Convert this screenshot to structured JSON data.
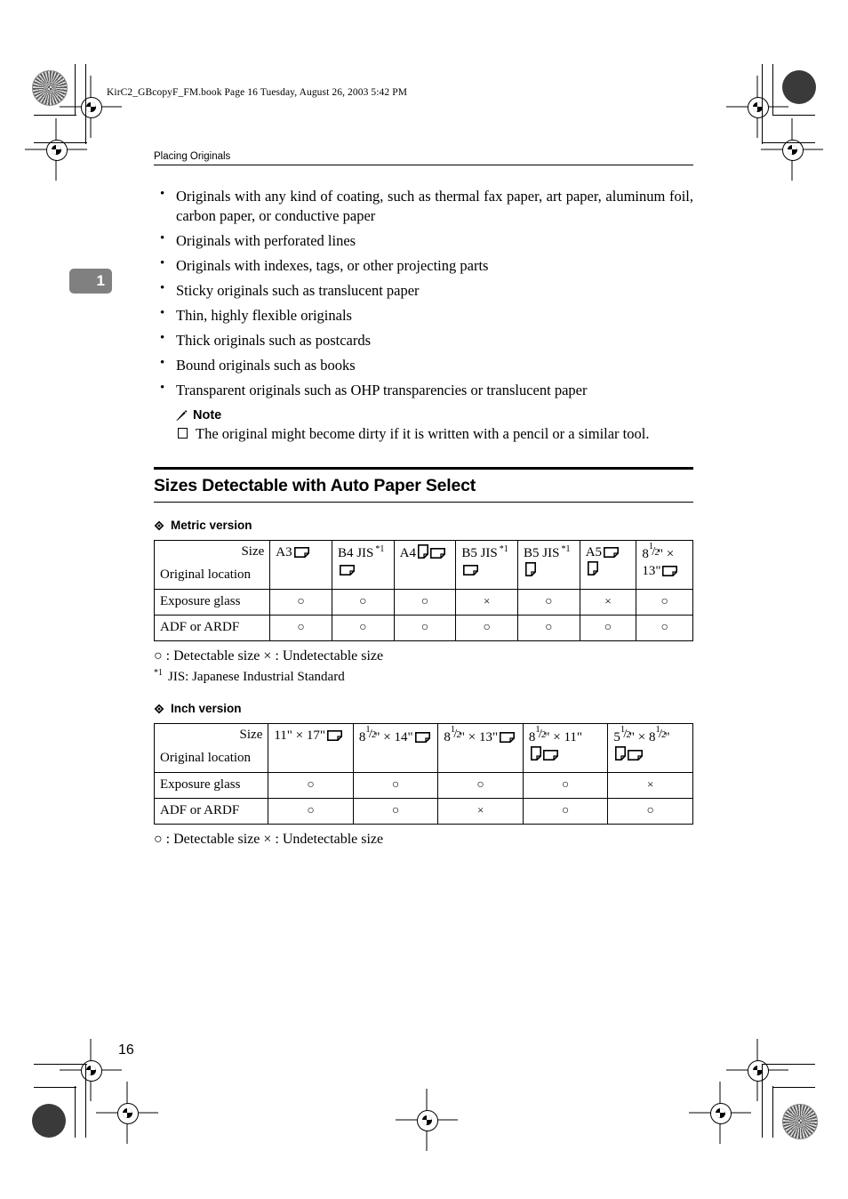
{
  "header": {
    "file_stamp": "KirC2_GBcopyF_FM.book  Page 16  Tuesday, August 26, 2003  5:42 PM"
  },
  "chapter_tab": "1",
  "page_number": "16",
  "running_head": "Placing Originals",
  "bullets": [
    "Originals with any kind of coating, such as thermal fax paper, art paper, aluminum foil, carbon paper, or conductive paper",
    "Originals with perforated lines",
    "Originals with indexes, tags, or other projecting parts",
    "Sticky originals such as translucent paper",
    "Thin, highly flexible originals",
    "Thick originals such as postcards",
    "Bound originals such as books",
    "Transparent originals such as OHP transparencies or translucent paper"
  ],
  "note": {
    "title": "Note",
    "items": [
      "The original might become dirty if it is written with a pencil or a similar tool."
    ]
  },
  "section": {
    "title": "Sizes Detectable with Auto Paper Select"
  },
  "metric": {
    "subhead": "Metric version",
    "corner_size_label": "Size",
    "corner_location_label": "Original location",
    "columns": [
      {
        "name": "A3",
        "jis": false,
        "orientations": [
          "landscape"
        ],
        "wrap_icon": false
      },
      {
        "name": "B4 JIS",
        "jis": true,
        "orientations": [
          "landscape"
        ],
        "wrap_icon": true
      },
      {
        "name": "A4",
        "jis": false,
        "orientations": [
          "portrait",
          "landscape"
        ],
        "wrap_icon": false
      },
      {
        "name": "B5 JIS",
        "jis": true,
        "orientations": [
          "landscape"
        ],
        "wrap_icon": true
      },
      {
        "name": "B5 JIS",
        "jis": true,
        "orientations": [
          "portrait"
        ],
        "wrap_icon": true
      },
      {
        "name": "A5",
        "jis": false,
        "orientations": [
          "landscape",
          "portrait"
        ],
        "wrap_icon": false
      },
      {
        "name": "8 1/2\" x 13\"",
        "jis": false,
        "orientations": [
          "landscape"
        ],
        "wrap_icon": false,
        "fraction": true
      }
    ],
    "rows": [
      {
        "label": "Exposure glass",
        "values": [
          "O",
          "O",
          "O",
          "X",
          "O",
          "X",
          "O"
        ]
      },
      {
        "label": "ADF or ARDF",
        "values": [
          "O",
          "O",
          "O",
          "O",
          "O",
          "O",
          "O"
        ]
      }
    ],
    "legend": "○ : Detectable size × : Undetectable size",
    "footnote_marker": "*1",
    "footnote": "JIS: Japanese Industrial Standard"
  },
  "inch": {
    "subhead": "Inch version",
    "corner_size_label": "Size",
    "corner_location_label": "Original location",
    "columns": [
      {
        "name": "11\" x 17\"",
        "orientations": [
          "landscape"
        ],
        "wrap_icon": false
      },
      {
        "name": "8 1/2\" x 14\"",
        "orientations": [
          "landscape"
        ],
        "wrap_icon": false,
        "fraction": true
      },
      {
        "name": "8 1/2\" x 13\"",
        "orientations": [
          "landscape"
        ],
        "wrap_icon": false,
        "fraction": true
      },
      {
        "name": "8 1/2\" x 11\"",
        "orientations": [
          "portrait",
          "landscape"
        ],
        "wrap_icon": true,
        "fraction": true
      },
      {
        "name": "5 1/2\" x 8 1/2\"",
        "orientations": [
          "portrait",
          "landscape"
        ],
        "wrap_icon": true,
        "fraction": true
      }
    ],
    "rows": [
      {
        "label": "Exposure glass",
        "values": [
          "O",
          "O",
          "O",
          "O",
          "X"
        ]
      },
      {
        "label": "ADF or ARDF",
        "values": [
          "O",
          "O",
          "X",
          "O",
          "O"
        ]
      }
    ],
    "legend": "○ : Detectable size × : Undetectable size"
  },
  "symbols": {
    "detectable": "○",
    "undetectable": "×"
  }
}
